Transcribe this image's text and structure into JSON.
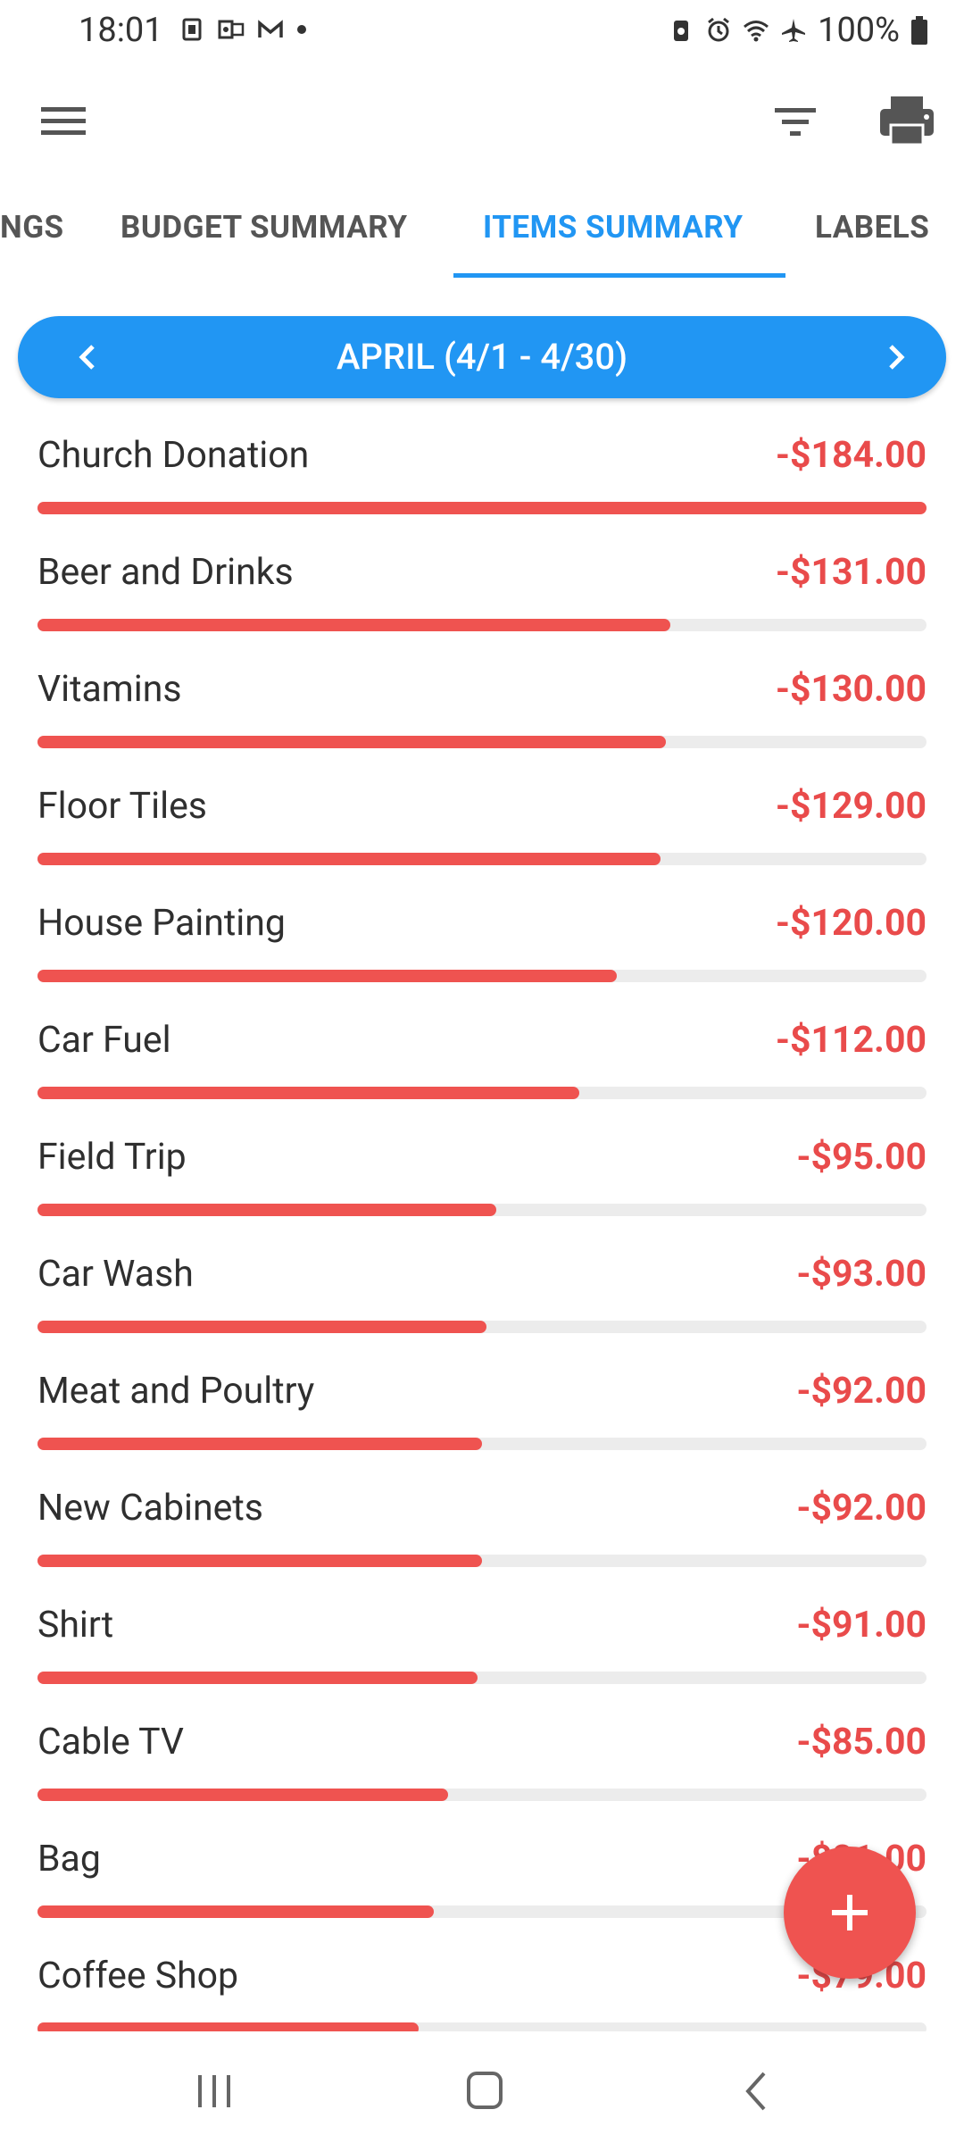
{
  "status_bar": {
    "time": "18:01",
    "battery": "100%",
    "left_icons": [
      "notification-icon",
      "outlook-icon",
      "gmail-icon",
      "dot-icon"
    ],
    "right_icons": [
      "battery-saver-icon",
      "alarm-icon",
      "wifi-icon",
      "airplane-icon",
      "battery-icon"
    ]
  },
  "app_bar": {
    "icons": [
      "menu-icon",
      "filter-icon",
      "print-icon"
    ]
  },
  "tabs": [
    {
      "label": "NGS",
      "active": false
    },
    {
      "label": "BUDGET SUMMARY",
      "active": false
    },
    {
      "label": "ITEMS SUMMARY",
      "active": true
    },
    {
      "label": "LABELS",
      "active": false
    }
  ],
  "month_selector": {
    "title": "APRIL (4/1 - 4/30)"
  },
  "items": [
    {
      "name": "Church Donation",
      "amount": "-$184.00",
      "ratio": 1.0
    },
    {
      "name": "Beer and Drinks",
      "amount": "-$131.00",
      "ratio": 0.712
    },
    {
      "name": "Vitamins",
      "amount": "-$130.00",
      "ratio": 0.707
    },
    {
      "name": "Floor Tiles",
      "amount": "-$129.00",
      "ratio": 0.701
    },
    {
      "name": "House Painting",
      "amount": "-$120.00",
      "ratio": 0.652
    },
    {
      "name": "Car Fuel",
      "amount": "-$112.00",
      "ratio": 0.609
    },
    {
      "name": "Field Trip",
      "amount": "-$95.00",
      "ratio": 0.516
    },
    {
      "name": "Car Wash",
      "amount": "-$93.00",
      "ratio": 0.505
    },
    {
      "name": "Meat and Poultry",
      "amount": "-$92.00",
      "ratio": 0.5
    },
    {
      "name": "New Cabinets",
      "amount": "-$92.00",
      "ratio": 0.5
    },
    {
      "name": "Shirt",
      "amount": "-$91.00",
      "ratio": 0.495
    },
    {
      "name": "Cable TV",
      "amount": "-$85.00",
      "ratio": 0.462
    },
    {
      "name": "Bag",
      "amount": "-$81.00",
      "ratio": 0.446
    },
    {
      "name": "Coffee Shop",
      "amount": "-$79.00",
      "ratio": 0.429
    }
  ],
  "colors": {
    "accent": "#2196f3",
    "expense": "#e94b4b",
    "bar": "#ef5350",
    "track": "#ececec"
  }
}
